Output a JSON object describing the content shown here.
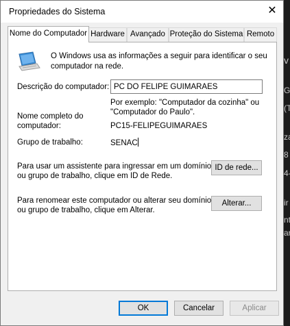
{
  "window": {
    "title": "Propriedades do Sistema",
    "close_glyph": "✕"
  },
  "tabs": [
    {
      "label": "Nome do Computador",
      "active": true
    },
    {
      "label": "Hardware",
      "active": false
    },
    {
      "label": "Avançado",
      "active": false
    },
    {
      "label": "Proteção do Sistema",
      "active": false
    },
    {
      "label": "Remoto",
      "active": false
    }
  ],
  "computer_name_tab": {
    "intro_line1": "O Windows usa as informações a seguir para identificar o seu",
    "intro_line2": "computador na rede.",
    "description_label": "Descrição do computador:",
    "description_value": "PC DO FELIPE GUIMARAES",
    "example_line1": "Por exemplo: \"Computador da cozinha\" ou",
    "example_line2": "\"Computador do Paulo\".",
    "full_name_label_line1": "Nome completo do",
    "full_name_label_line2": "computador:",
    "full_name_value": "PC15-FELIPEGUIMARAES",
    "workgroup_label": "Grupo de trabalho:",
    "workgroup_value": "SENAC",
    "network_id_text_line1": "Para usar um assistente para ingressar em um domínio",
    "network_id_text_line2": "ou grupo de trabalho, clique em ID de Rede.",
    "network_id_button": "ID de rede...",
    "rename_text_line1": "Para renomear este computador ou alterar seu domínio",
    "rename_text_line2": "ou grupo de trabalho, clique em Alterar.",
    "change_button": "Alterar..."
  },
  "footer": {
    "ok": "OK",
    "cancel": "Cancelar",
    "apply": "Aplicar"
  },
  "background_fragments": [
    "v",
    "G",
    "(T",
    "za",
    "8",
    "4-",
    "ir",
    "nt",
    "ar"
  ],
  "colors": {
    "accent": "#0078d7",
    "monitor": "#3c8fd6"
  }
}
